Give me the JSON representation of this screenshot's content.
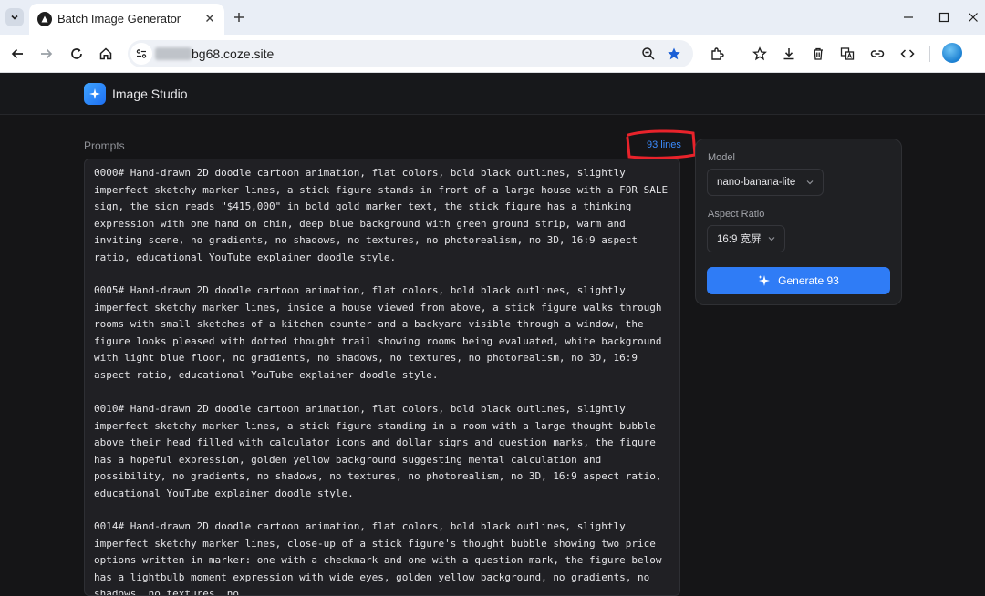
{
  "browser": {
    "tab_title": "Batch Image Generator",
    "url": "bg68.coze.site"
  },
  "app": {
    "title": "Image Studio"
  },
  "prompts": {
    "label": "Prompts",
    "line_count": "93 lines",
    "blocks": [
      "0000# Hand-drawn 2D doodle cartoon animation, flat colors, bold black outlines, slightly imperfect sketchy marker lines, a stick figure stands in front of a large house with a FOR SALE sign, the sign reads \"$415,000\" in bold gold marker text, the stick figure has a thinking expression with one hand on chin, deep blue background with green ground strip, warm and inviting scene, no gradients, no shadows, no textures, no photorealism, no 3D, 16:9 aspect ratio, educational YouTube explainer doodle style.",
      "0005# Hand-drawn 2D doodle cartoon animation, flat colors, bold black outlines, slightly imperfect sketchy marker lines, inside a house viewed from above, a stick figure walks through rooms with small sketches of a kitchen counter and a backyard visible through a window, the figure looks pleased with dotted thought trail showing rooms being evaluated, white background with light blue floor, no gradients, no shadows, no textures, no photorealism, no 3D, 16:9 aspect ratio, educational YouTube explainer doodle style.",
      "0010# Hand-drawn 2D doodle cartoon animation, flat colors, bold black outlines, slightly imperfect sketchy marker lines, a stick figure standing in a room with a large thought bubble above their head filled with calculator icons and dollar signs and question marks, the figure has a hopeful expression, golden yellow background suggesting mental calculation and possibility, no gradients, no shadows, no textures, no photorealism, no 3D, 16:9 aspect ratio, educational YouTube explainer doodle style.",
      "0014# Hand-drawn 2D doodle cartoon animation, flat colors, bold black outlines, slightly imperfect sketchy marker lines, close-up of a stick figure's thought bubble showing two price options written in marker: one with a checkmark and one with a question mark, the figure below has a lightbulb moment expression with wide eyes, golden yellow background, no gradients, no shadows, no textures, no"
    ]
  },
  "settings": {
    "model_label": "Model",
    "model_value": "nano-banana-lite",
    "aspect_label": "Aspect Ratio",
    "aspect_value": "16:9 宽屏",
    "generate_label": "Generate 93"
  },
  "colors": {
    "accent": "#2f7cf6",
    "background": "#151517",
    "panel": "#1f2023",
    "annotation": "#e8232b"
  }
}
